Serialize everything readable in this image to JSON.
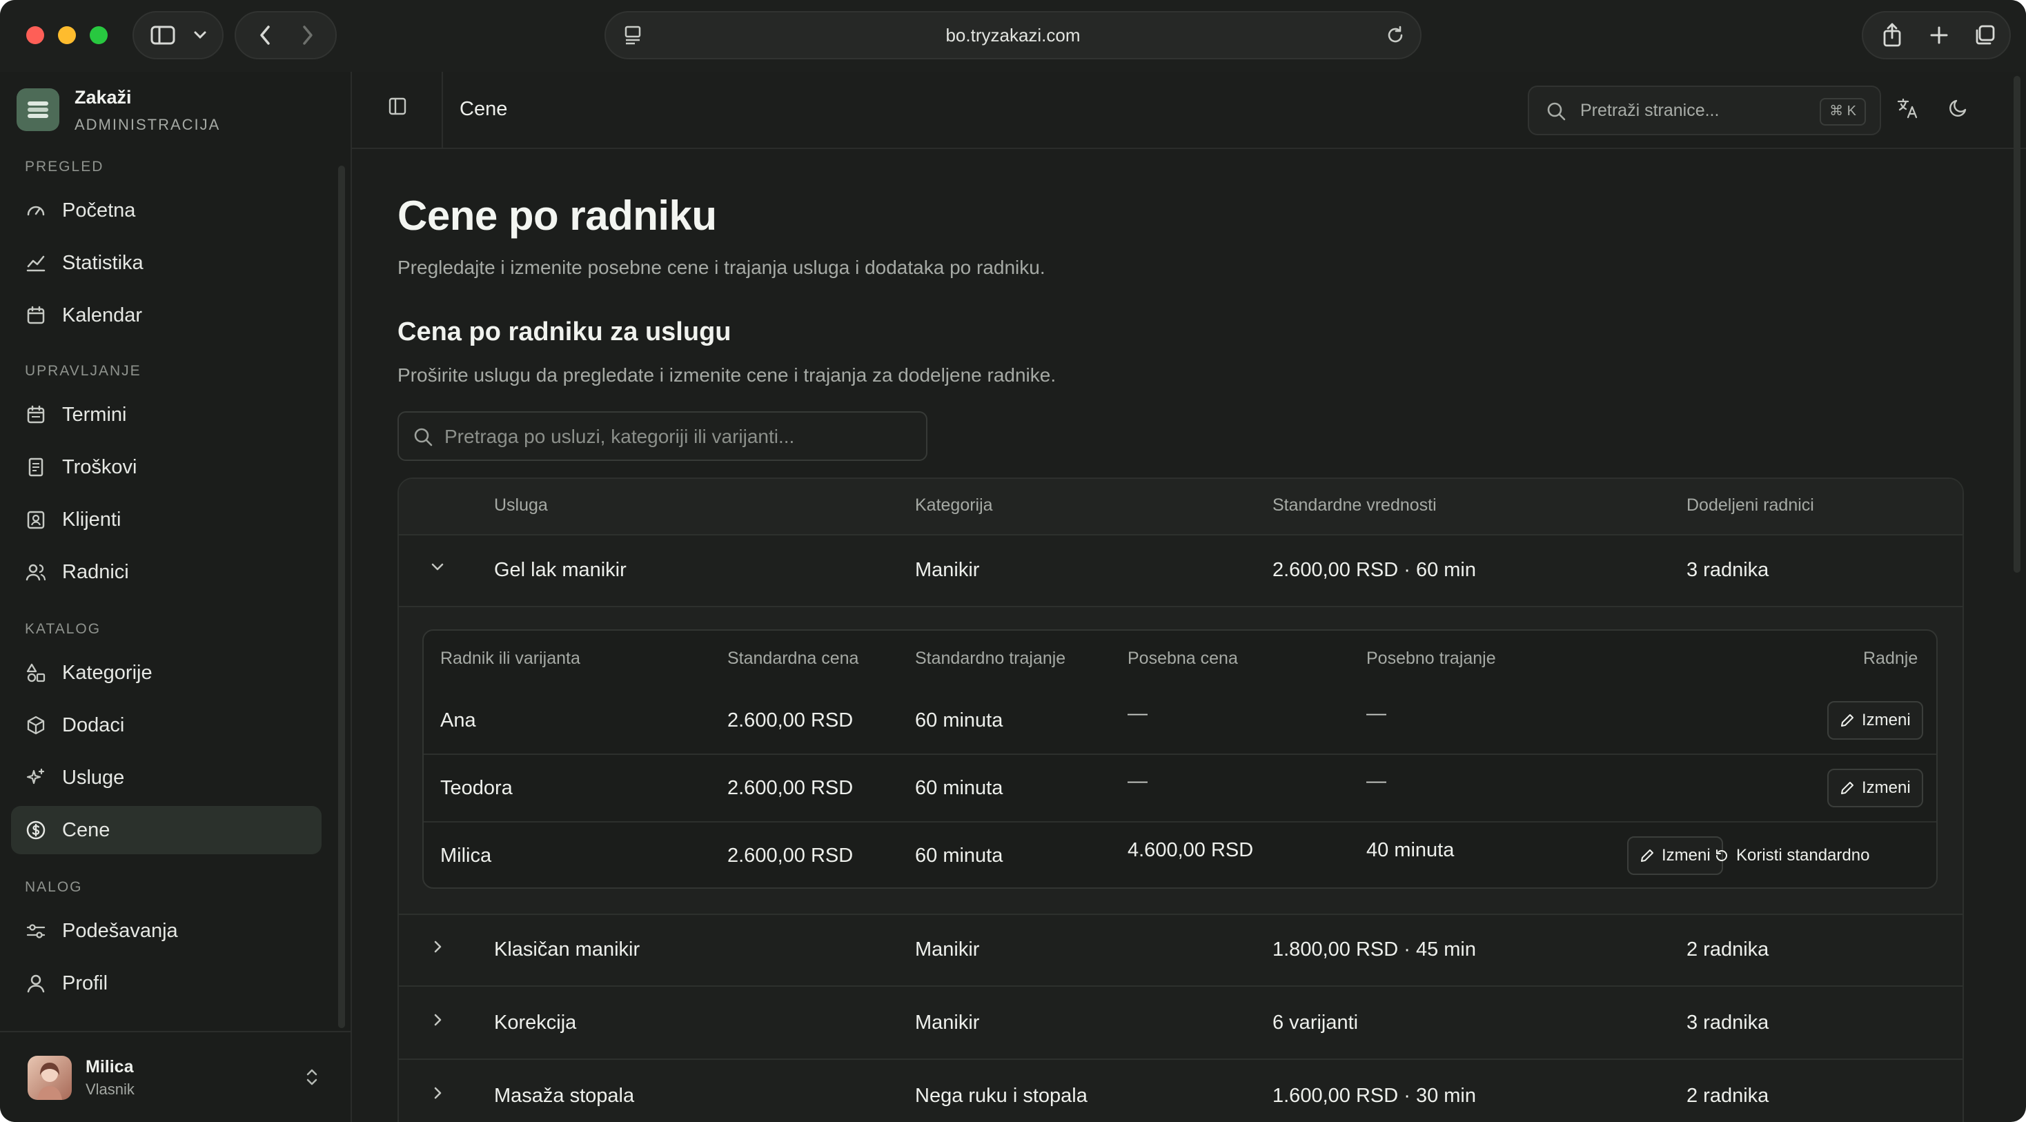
{
  "browser": {
    "url": "bo.tryzakazi.com"
  },
  "brand": {
    "title": "Zakaži",
    "subtitle": "ADMINISTRACIJA"
  },
  "sidebar": {
    "sections": [
      {
        "label": "PREGLED",
        "items": [
          {
            "label": "Početna",
            "icon": "gauge-icon"
          },
          {
            "label": "Statistika",
            "icon": "chart-icon"
          },
          {
            "label": "Kalendar",
            "icon": "calendar-icon"
          }
        ]
      },
      {
        "label": "UPRAVLJANJE",
        "items": [
          {
            "label": "Termini",
            "icon": "calendar-check-icon"
          },
          {
            "label": "Troškovi",
            "icon": "receipt-icon"
          },
          {
            "label": "Klijenti",
            "icon": "contact-icon"
          },
          {
            "label": "Radnici",
            "icon": "users-icon"
          }
        ]
      },
      {
        "label": "KATALOG",
        "items": [
          {
            "label": "Kategorije",
            "icon": "shapes-icon"
          },
          {
            "label": "Dodaci",
            "icon": "package-icon"
          },
          {
            "label": "Usluge",
            "icon": "sparkles-icon"
          },
          {
            "label": "Cene",
            "icon": "dollar-icon",
            "active": true
          }
        ]
      },
      {
        "label": "NALOG",
        "items": [
          {
            "label": "Podešavanja",
            "icon": "sliders-icon"
          },
          {
            "label": "Profil",
            "icon": "user-icon"
          }
        ]
      }
    ],
    "user": {
      "name": "Milica",
      "role": "Vlasnik"
    }
  },
  "header": {
    "title": "Cene",
    "search_placeholder": "Pretraži stranice...",
    "search_shortcut": "⌘ K"
  },
  "page": {
    "title": "Cene po radniku",
    "subtitle": "Pregledajte i izmenite posebne cene i trajanja usluga i dodataka po radniku.",
    "section_title": "Cena po radniku za uslugu",
    "section_subtitle": "Proširite uslugu da pregledate i izmenite cene i trajanja za dodeljene radnike.",
    "search_placeholder": "Pretraga po usluzi, kategoriji ili varijanti..."
  },
  "table": {
    "headers": {
      "service": "Usluga",
      "category": "Kategorija",
      "defaults": "Standardne vrednosti",
      "assigned": "Dodeljeni radnici"
    },
    "rows": [
      {
        "service": "Gel lak manikir",
        "category": "Manikir",
        "defaults": "2.600,00 RSD · 60 min",
        "assigned": "3 radnika",
        "expanded": true
      },
      {
        "service": "Klasičan manikir",
        "category": "Manikir",
        "defaults": "1.800,00 RSD · 45 min",
        "assigned": "2 radnika"
      },
      {
        "service": "Korekcija",
        "category": "Manikir",
        "defaults": "6 varijanti",
        "assigned": "3 radnika"
      },
      {
        "service": "Masaža stopala",
        "category": "Nega ruku i stopala",
        "defaults": "1.600,00 RSD · 30 min",
        "assigned": "2 radnika"
      }
    ]
  },
  "inner": {
    "headers": {
      "worker": "Radnik ili varijanta",
      "std_price": "Standardna cena",
      "std_duration": "Standardno trajanje",
      "special_price": "Posebna cena",
      "special_duration": "Posebno trajanje",
      "actions": "Radnje"
    },
    "rows": [
      {
        "worker": "Ana",
        "std_price": "2.600,00 RSD",
        "std_duration": "60 minuta",
        "special_price": "—",
        "special_duration": "—",
        "edit": "Izmeni"
      },
      {
        "worker": "Teodora",
        "std_price": "2.600,00 RSD",
        "std_duration": "60 minuta",
        "special_price": "—",
        "special_duration": "—",
        "edit": "Izmeni"
      },
      {
        "worker": "Milica",
        "std_price": "2.600,00 RSD",
        "std_duration": "60 minuta",
        "special_price": "4.600,00 RSD",
        "special_duration": "40 minuta",
        "edit": "Izmeni",
        "reset": "Koristi standardno"
      }
    ]
  }
}
